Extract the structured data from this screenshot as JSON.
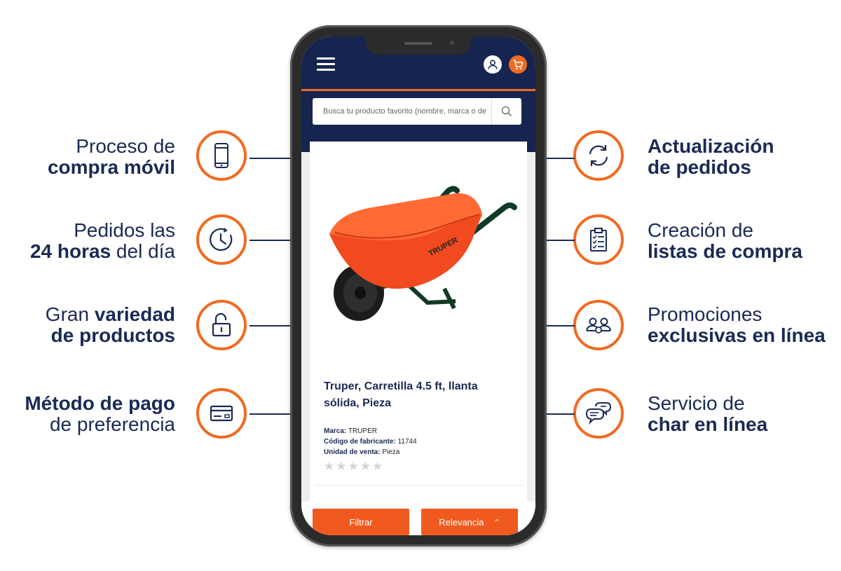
{
  "features_left": [
    {
      "line1_normal": "Proceso de",
      "line2_bold": "compra móvil",
      "icon": "smartphone-icon"
    },
    {
      "line1_normal": "Pedidos las",
      "line2_bold": "24 horas",
      "line2_normal": " del día",
      "icon": "clock-icon"
    },
    {
      "line1_normal": "Gran ",
      "line1_bold": "variedad",
      "line2_bold": "de productos",
      "icon": "unlock-icon"
    },
    {
      "line1_bold": "Método de pago",
      "line2_normal": "de preferencia",
      "icon": "credit-card-icon"
    }
  ],
  "features_right": [
    {
      "line1_bold": "Actualización",
      "line2_bold": "de pedidos",
      "icon": "refresh-icon"
    },
    {
      "line1_normal": "Creación de",
      "line2_bold": "listas de compra",
      "icon": "clipboard-list-icon"
    },
    {
      "line1_normal": "Promociones",
      "line2_bold": "exclusivas en línea",
      "icon": "group-badge-icon"
    },
    {
      "line1_normal": "Servicio de",
      "line2_bold": "char en línea",
      "icon": "chat-bubbles-icon"
    }
  ],
  "app": {
    "search_placeholder": "Busca tu producto favorito (nombre, marca o de",
    "product": {
      "title": "Truper, Carretilla 4.5 ft, llanta sólida, Pieza",
      "brand_label": "Marca:",
      "brand_value": " TRUPER",
      "mfr_label": "Código de fabricante:",
      "mfr_value": " 11744",
      "unit_label": "Unidad de venta:",
      "unit_value": " Pieza",
      "rating": 0,
      "stars": "★★★★★",
      "image_text": "TRUPER"
    },
    "filter_label": "Filtrar",
    "sort_label": "Relevancia",
    "sort_chevron": "⌃"
  },
  "colors": {
    "navy": "#16254f",
    "orange": "#f26a21",
    "button_orange": "#f15a1f"
  }
}
